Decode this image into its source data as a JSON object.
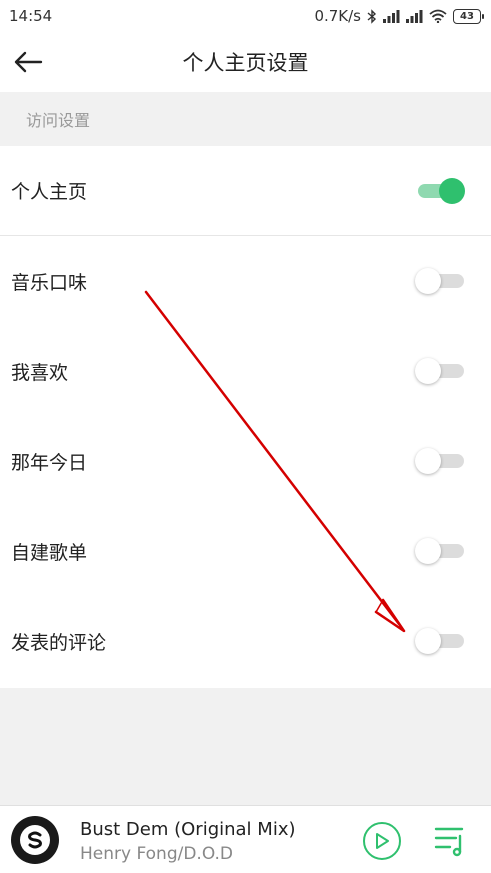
{
  "status_bar": {
    "time": "14:54",
    "network_speed": "0.7K/s",
    "battery": "43",
    "icons": [
      "bluetooth-icon",
      "signal-icon",
      "signal-icon",
      "wifi-icon",
      "battery-icon"
    ]
  },
  "header": {
    "title": "个人主页设置",
    "back_icon": "back-arrow-icon"
  },
  "section": {
    "label": "访问设置"
  },
  "settings": [
    {
      "label": "个人主页",
      "enabled": true
    },
    {
      "label": "音乐口味",
      "enabled": false
    },
    {
      "label": "我喜欢",
      "enabled": false
    },
    {
      "label": "那年今日",
      "enabled": false
    },
    {
      "label": "自建歌单",
      "enabled": false
    },
    {
      "label": "发表的评论",
      "enabled": false
    }
  ],
  "player": {
    "title": "Bust Dem (Original Mix)",
    "artist": "Henry Fong/D.O.D",
    "play_icon": "play-icon",
    "playlist_icon": "playlist-icon"
  },
  "colors": {
    "accent": "#2fc06e",
    "annotation": "#d40000"
  }
}
